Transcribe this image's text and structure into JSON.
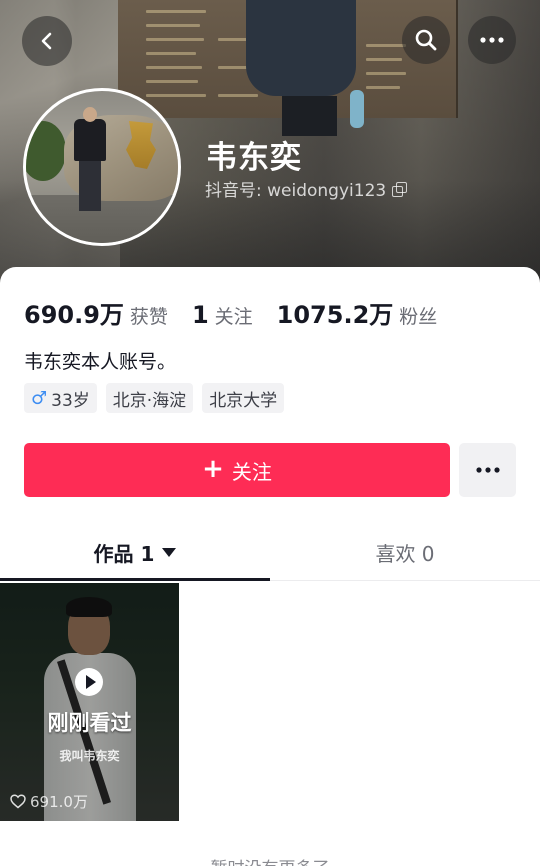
{
  "profile": {
    "name": "韦东奕",
    "handle": "抖音号: weidongyi123",
    "bio": "韦东奕本人账号。"
  },
  "stats": {
    "likes_value": "690.9万",
    "likes_label": "获赞",
    "following_value": "1",
    "following_label": "关注",
    "followers_value": "1075.2万",
    "followers_label": "粉丝"
  },
  "tags": {
    "age": "33岁",
    "location": "北京·海淀",
    "school": "北京大学"
  },
  "actions": {
    "follow_label": "关注"
  },
  "tabs": {
    "works": "作品 1",
    "likes": "喜欢 0"
  },
  "video": {
    "badge": "刚刚看过",
    "caption": "我叫韦东奕",
    "like_count": "691.0万"
  },
  "footer": {
    "no_more": "暂时没有更多了"
  },
  "colors": {
    "accent": "#fe2c55",
    "male": "#3d8df2"
  },
  "icons": [
    "back-icon",
    "search-icon",
    "more-icon",
    "copy-icon",
    "male-icon",
    "plus-icon",
    "play-icon",
    "heart-icon",
    "caret-down-icon"
  ]
}
